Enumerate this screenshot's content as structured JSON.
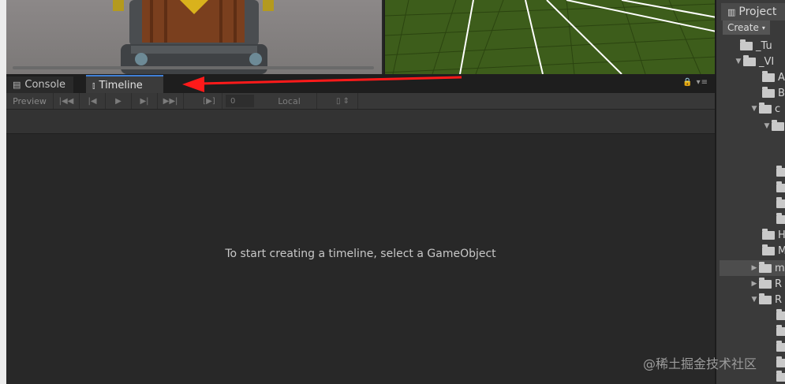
{
  "timeline_window": {
    "tabs": [
      {
        "label": "Console",
        "icon": "console-icon"
      },
      {
        "label": "Timeline",
        "icon": "timeline-icon",
        "active": true
      }
    ],
    "toolbar": {
      "preview_label": "Preview",
      "frame_value": "0",
      "space_label": "Local"
    },
    "empty_message": "To start creating a timeline, select a GameObject"
  },
  "project_panel": {
    "tab_label": "Project",
    "create_label": "Create",
    "tree": [
      {
        "label": "_Tu"
      },
      {
        "label": "_VI"
      },
      {
        "label": "A"
      },
      {
        "label": "B"
      },
      {
        "label": "c"
      },
      {
        "label": ""
      },
      {
        "label": ""
      },
      {
        "label": ""
      },
      {
        "label": ""
      },
      {
        "label": ""
      },
      {
        "label": "H"
      },
      {
        "label": "M"
      },
      {
        "label": "m"
      },
      {
        "label": "R"
      },
      {
        "label": "R"
      },
      {
        "label": ""
      },
      {
        "label": ""
      },
      {
        "label": ""
      },
      {
        "label": ""
      },
      {
        "label": ""
      }
    ]
  },
  "watermark": "@稀土掘金技术社区",
  "colors": {
    "annotation_arrow": "#ff1a1a",
    "active_tab_accent": "#3f7fd6",
    "editor_background": "#282828",
    "grass": "#3b5a1a"
  }
}
